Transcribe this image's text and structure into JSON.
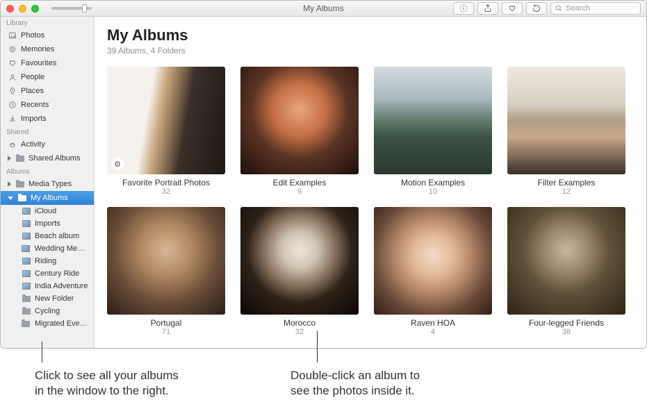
{
  "window": {
    "title": "My Albums",
    "search_placeholder": "Search"
  },
  "sidebar": {
    "sections": {
      "library": "Library",
      "shared": "Shared",
      "albums": "Albums"
    },
    "library_items": [
      {
        "label": "Photos"
      },
      {
        "label": "Memories"
      },
      {
        "label": "Favourites"
      },
      {
        "label": "People"
      },
      {
        "label": "Places"
      },
      {
        "label": "Recents"
      },
      {
        "label": "Imports"
      }
    ],
    "shared_items": [
      {
        "label": "Activity"
      },
      {
        "label": "Shared Albums"
      }
    ],
    "albums_items": [
      {
        "label": "Media Types"
      },
      {
        "label": "My Albums"
      }
    ],
    "my_albums_children": [
      {
        "label": "iCloud"
      },
      {
        "label": "Imports"
      },
      {
        "label": "Beach album"
      },
      {
        "label": "Wedding Mem…"
      },
      {
        "label": "Riding"
      },
      {
        "label": "Century Ride"
      },
      {
        "label": "India Adventure"
      },
      {
        "label": "New Folder"
      },
      {
        "label": "Cycling"
      },
      {
        "label": "Migrated Events"
      }
    ]
  },
  "main": {
    "title": "My Albums",
    "subtitle": "39 Albums, 4 Folders"
  },
  "albums": [
    {
      "name": "Favorite Portrait Photos",
      "count": "32",
      "cov": "cov1",
      "smart": true
    },
    {
      "name": "Edit Examples",
      "count": "9",
      "cov": "cov2",
      "smart": false
    },
    {
      "name": "Motion Examples",
      "count": "10",
      "cov": "cov3",
      "smart": false
    },
    {
      "name": "Filter Examples",
      "count": "12",
      "cov": "cov4",
      "smart": false
    },
    {
      "name": "Portugal",
      "count": "71",
      "cov": "cov5",
      "smart": false
    },
    {
      "name": "Morocco",
      "count": "32",
      "cov": "cov6",
      "smart": false
    },
    {
      "name": "Raven HOA",
      "count": "4",
      "cov": "cov7",
      "smart": false
    },
    {
      "name": "Four-legged Friends",
      "count": "38",
      "cov": "cov8",
      "smart": false
    }
  ],
  "callouts": {
    "left": "Click to see all your albums\nin the window to the right.",
    "right": "Double-click an album to\nsee the photos inside it."
  }
}
